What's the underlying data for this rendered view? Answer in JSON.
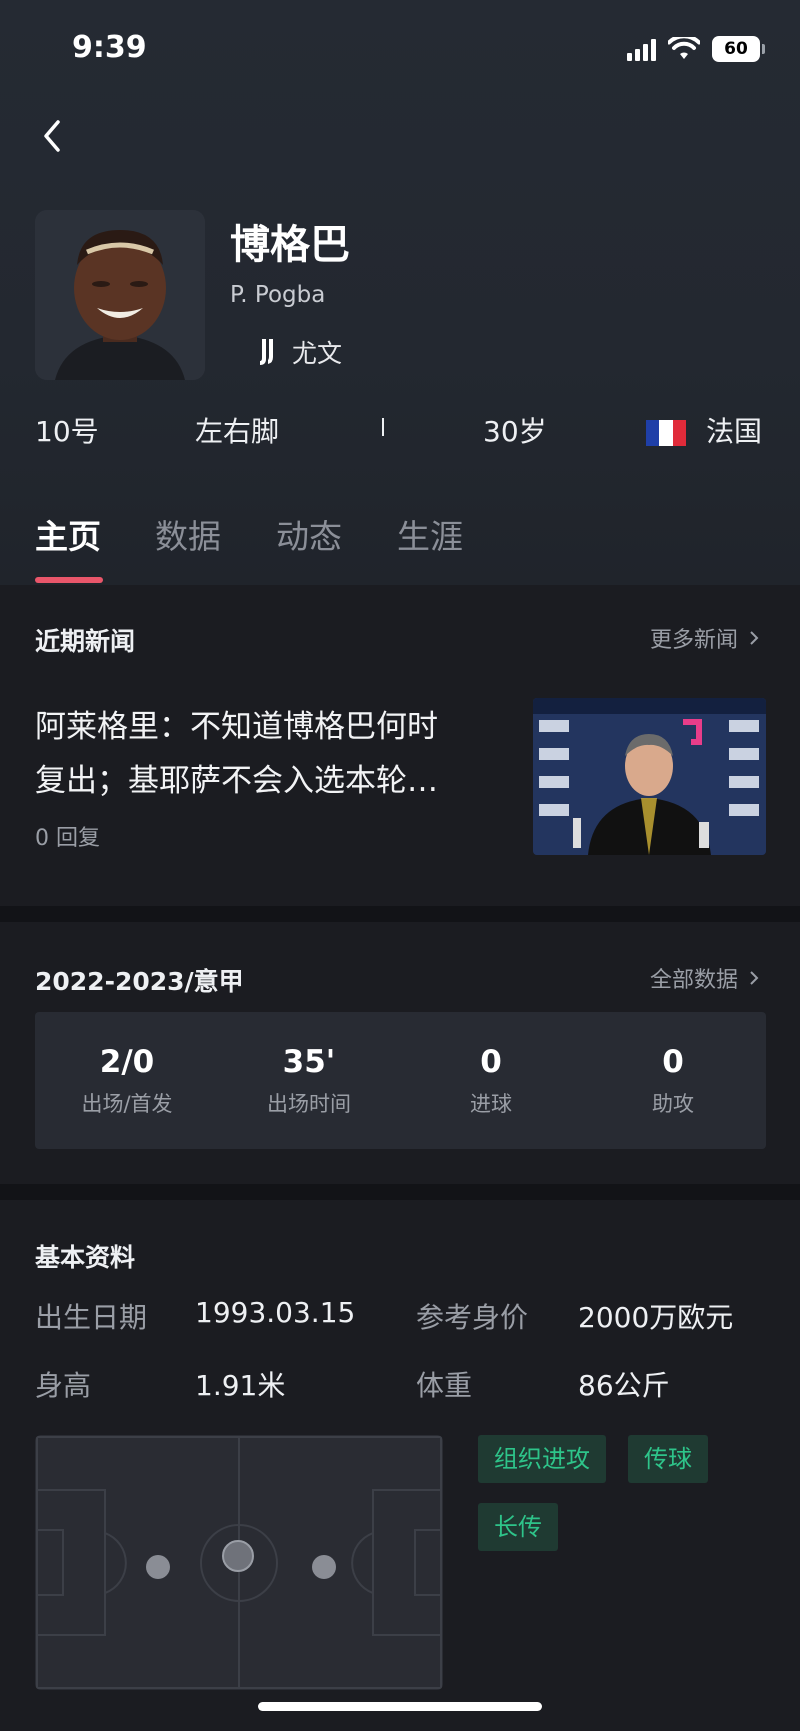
{
  "status_bar": {
    "time": "9:39",
    "battery": "60"
  },
  "player": {
    "name_cn": "博格巴",
    "name_en": "P. Pogba",
    "club": "尤文",
    "number": "10号",
    "foot": "左右脚",
    "age": "30岁",
    "nationality": "法国"
  },
  "tabs": [
    {
      "label": "主页",
      "active": true
    },
    {
      "label": "数据",
      "active": false
    },
    {
      "label": "动态",
      "active": false
    },
    {
      "label": "生涯",
      "active": false
    }
  ],
  "news": {
    "section_title": "近期新闻",
    "more_label": "更多新闻",
    "title_line1": "阿莱格里：不知道博格巴何时",
    "title_line2": "复出；基耶萨不会入选本轮…",
    "replies": "0 回复"
  },
  "season_stats": {
    "section_title": "2022-2023/意甲",
    "more_label": "全部数据",
    "items": [
      {
        "value": "2/0",
        "label": "出场/首发"
      },
      {
        "value": "35'",
        "label": "出场时间"
      },
      {
        "value": "0",
        "label": "进球"
      },
      {
        "value": "0",
        "label": "助攻"
      }
    ]
  },
  "basic_info": {
    "section_title": "基本资料",
    "birth_label": "出生日期",
    "birth_value": "1993.03.15",
    "value_label": "参考身价",
    "value_value": "2000万欧元",
    "height_label": "身高",
    "height_value": "1.91米",
    "weight_label": "体重",
    "weight_value": "86公斤"
  },
  "tags": [
    "组织进攻",
    "传球",
    "长传"
  ],
  "colors": {
    "accent": "#e9566a",
    "tag_text": "#2ec48a",
    "tag_bg": "#1f3a32",
    "background": "#1b1c21"
  }
}
